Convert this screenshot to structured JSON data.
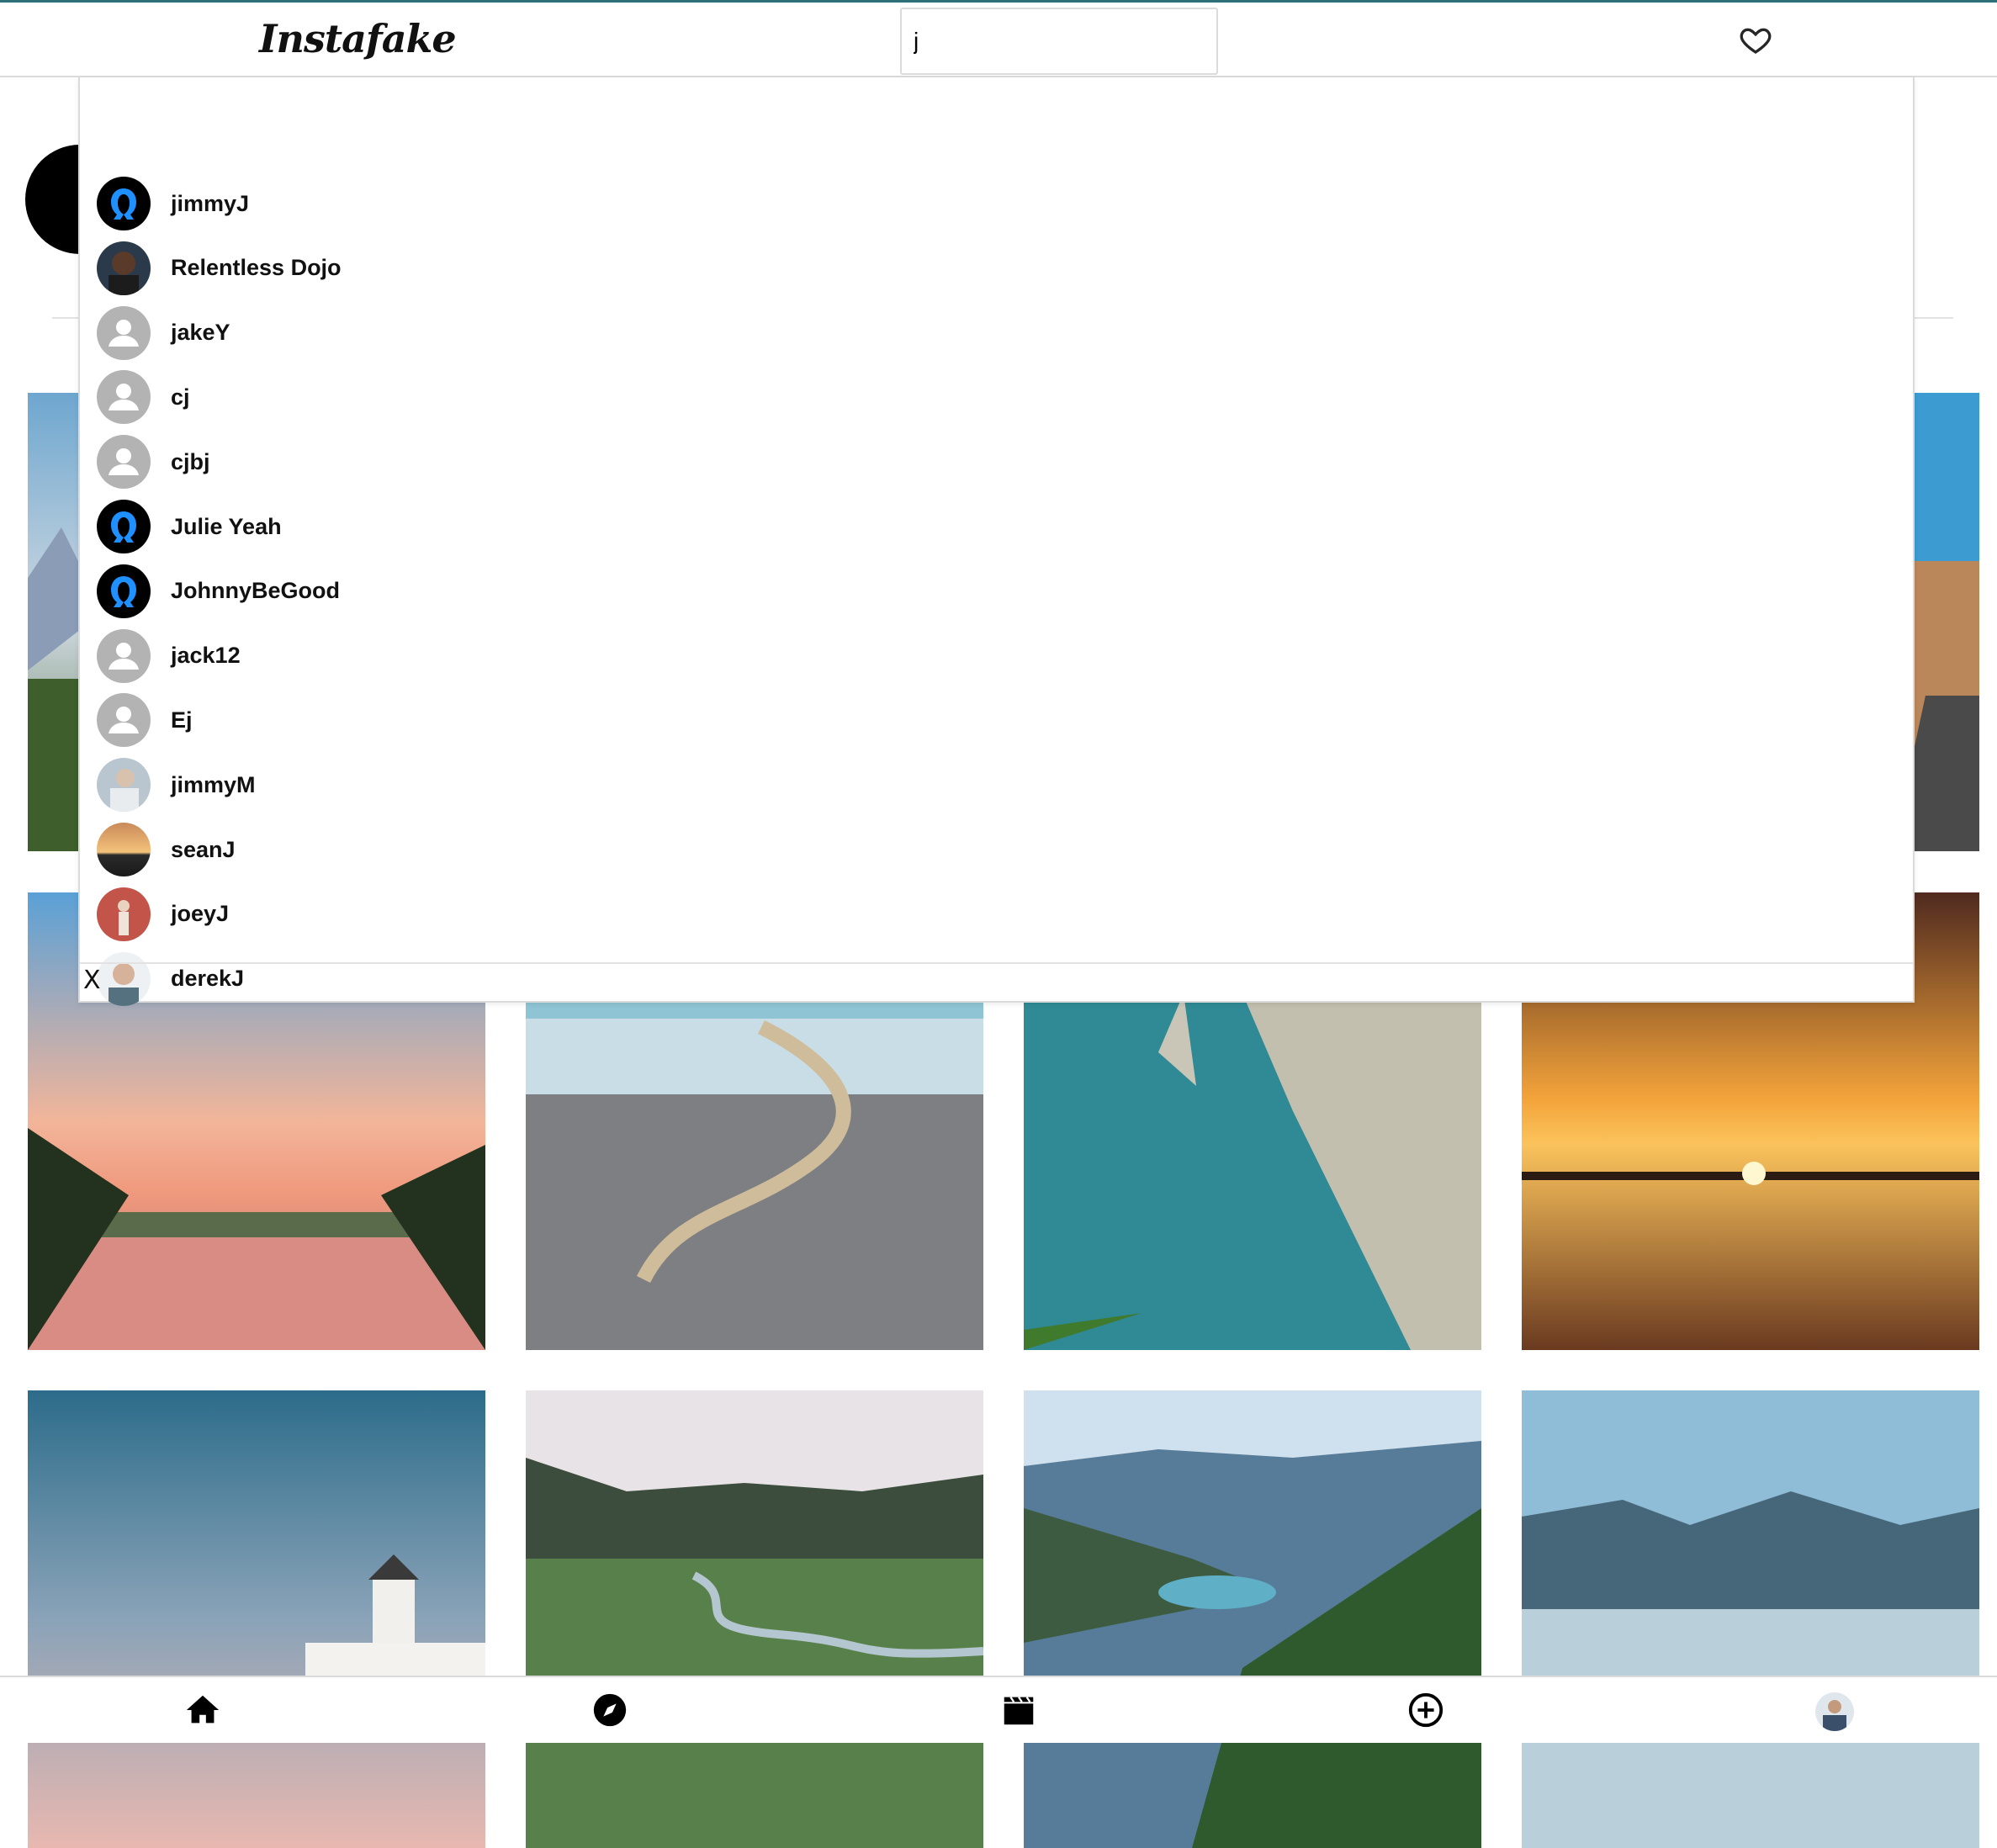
{
  "app": {
    "logo_text": "Instafake"
  },
  "search": {
    "value": "j"
  },
  "results": [
    {
      "username": "jimmyJ",
      "avatar": "blue-silhouette"
    },
    {
      "username": "Relentless Dojo",
      "avatar": "photo-dark"
    },
    {
      "username": "jakeY",
      "avatar": "default-gray"
    },
    {
      "username": "cj",
      "avatar": "default-gray"
    },
    {
      "username": "cjbj",
      "avatar": "default-gray"
    },
    {
      "username": "Julie Yeah",
      "avatar": "blue-silhouette"
    },
    {
      "username": "JohnnyBeGood",
      "avatar": "blue-silhouette"
    },
    {
      "username": "jack12",
      "avatar": "default-gray"
    },
    {
      "username": "Ej",
      "avatar": "default-gray"
    },
    {
      "username": "jimmyM",
      "avatar": "photo-gray"
    },
    {
      "username": "seanJ",
      "avatar": "photo-sunset"
    },
    {
      "username": "joeyJ",
      "avatar": "photo-red"
    },
    {
      "username": "derekJ",
      "avatar": "photo-man"
    }
  ],
  "dropdown": {
    "close_label": "X"
  },
  "grid": {
    "photos": [
      "mountain-valley",
      "desert-road",
      "palm-sunset-lake",
      "icy-shore-rope",
      "cliff-coast",
      "sunset-reflection",
      "windmill-dusk",
      "river-valley",
      "alpine-lake",
      "mountain-reflection"
    ]
  },
  "nav": {
    "icons": [
      "home-icon",
      "explore-icon",
      "reels-icon",
      "add-post-icon",
      "profile-avatar"
    ]
  },
  "colors": {
    "border": "#dbdbdb",
    "silhouette_blue": "#1e90ff",
    "default_avatar_gray": "#b3b3b3"
  }
}
